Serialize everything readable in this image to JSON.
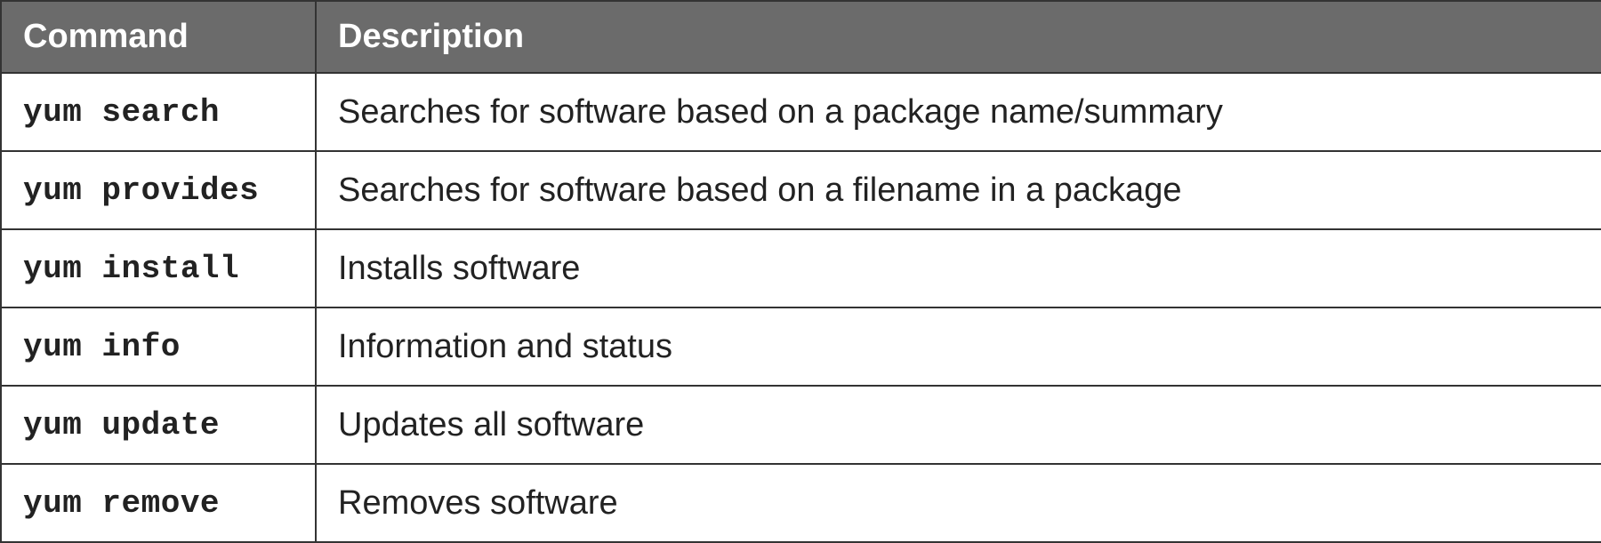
{
  "headers": {
    "command": "Command",
    "description": "Description"
  },
  "rows": [
    {
      "command": "yum search",
      "description": "Searches for software based on a package name/summary"
    },
    {
      "command": "yum provides",
      "description": "Searches for software based on a filename in a package"
    },
    {
      "command": "yum install",
      "description": "Installs software"
    },
    {
      "command": "yum info",
      "description": "Information and status"
    },
    {
      "command": "yum update",
      "description": "Updates all software"
    },
    {
      "command": "yum remove",
      "description": "Removes software"
    }
  ]
}
